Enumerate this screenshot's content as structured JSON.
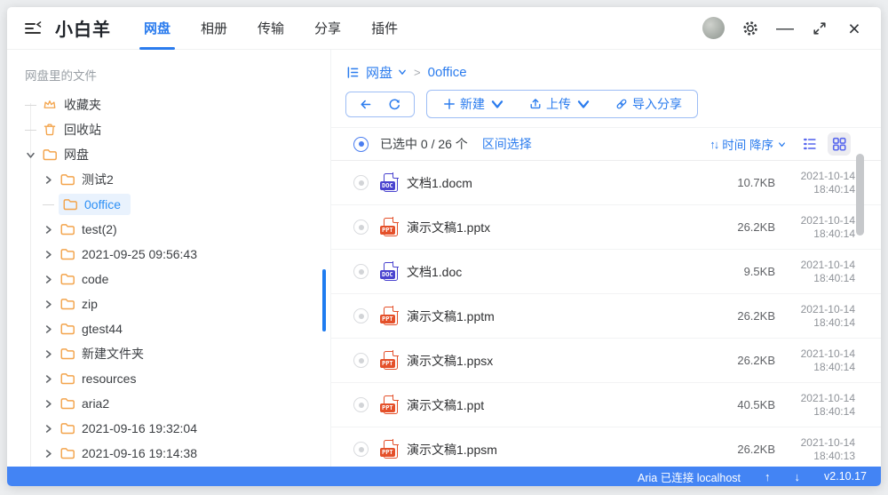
{
  "colors": {
    "accent": "#2b7cee",
    "statusbar": "#4384f4",
    "view_icon": "#5a69ee",
    "folder": "#f3a44c",
    "doc_icon": "#4a43cf",
    "ppt_icon": "#e4502a",
    "sel_bg": "#e9f2fd",
    "sel_text": "#2e90f5"
  },
  "header": {
    "title": "小白羊",
    "tabs": [
      {
        "label": "网盘",
        "active": true
      },
      {
        "label": "相册",
        "active": false
      },
      {
        "label": "传输",
        "active": false
      },
      {
        "label": "分享",
        "active": false
      },
      {
        "label": "插件",
        "active": false
      }
    ]
  },
  "sidebar": {
    "header": "网盘里的文件",
    "items": [
      {
        "label": "收藏夹",
        "icon": "crown"
      },
      {
        "label": "回收站",
        "icon": "trash"
      },
      {
        "label": "网盘",
        "icon": "folder",
        "state": "expanded"
      },
      {
        "label": "测试2",
        "icon": "folder"
      },
      {
        "label": "0office",
        "icon": "folder",
        "selected": true
      },
      {
        "label": "test(2)",
        "icon": "folder"
      },
      {
        "label": "2021-09-25 09:56:43",
        "icon": "folder"
      },
      {
        "label": "code",
        "icon": "folder"
      },
      {
        "label": "zip",
        "icon": "folder"
      },
      {
        "label": "gtest44",
        "icon": "folder"
      },
      {
        "label": "新建文件夹",
        "icon": "folder"
      },
      {
        "label": "resources",
        "icon": "folder"
      },
      {
        "label": "aria2",
        "icon": "folder"
      },
      {
        "label": "2021-09-16 19:32:04",
        "icon": "folder"
      },
      {
        "label": "2021-09-16 19:14:38",
        "icon": "folder"
      },
      {
        "label": "",
        "icon": "folder"
      }
    ]
  },
  "breadcrumb": {
    "root": "网盘",
    "sep": ">",
    "current": "0office"
  },
  "toolbar": {
    "new": "新建",
    "upload": "上传",
    "import": "导入分享"
  },
  "list_header": {
    "selected": "已选中 0 / 26 个",
    "range": "区间选择",
    "sort": "时间 降序"
  },
  "files": {
    "rows": [
      {
        "name": "文档1.docm",
        "badge": "DOC",
        "type": "doc",
        "size": "10.7KB",
        "date": "2021-10-14",
        "time": "18:40:14"
      },
      {
        "name": "演示文稿1.pptx",
        "badge": "PPT",
        "type": "ppt",
        "size": "26.2KB",
        "date": "2021-10-14",
        "time": "18:40:14"
      },
      {
        "name": "文档1.doc",
        "badge": "DOC",
        "type": "doc",
        "size": "9.5KB",
        "date": "2021-10-14",
        "time": "18:40:14"
      },
      {
        "name": "演示文稿1.pptm",
        "badge": "PPT",
        "type": "ppt",
        "size": "26.2KB",
        "date": "2021-10-14",
        "time": "18:40:14"
      },
      {
        "name": "演示文稿1.ppsx",
        "badge": "PPT",
        "type": "ppt",
        "size": "26.2KB",
        "date": "2021-10-14",
        "time": "18:40:14"
      },
      {
        "name": "演示文稿1.ppt",
        "badge": "PPT",
        "type": "ppt",
        "size": "40.5KB",
        "date": "2021-10-14",
        "time": "18:40:14"
      },
      {
        "name": "演示文稿1.ppsm",
        "badge": "PPT",
        "type": "ppt",
        "size": "26.2KB",
        "date": "2021-10-14",
        "time": "18:40:13"
      }
    ]
  },
  "statusbar": {
    "aria": "Aria 已连接 localhost",
    "version": "v2.10.17"
  }
}
